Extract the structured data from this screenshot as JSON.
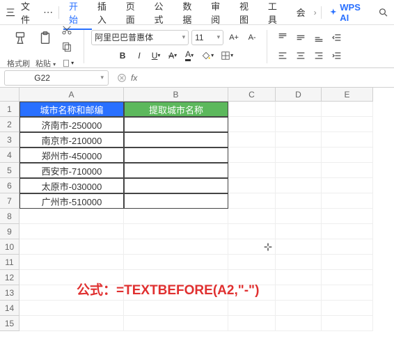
{
  "menubar": {
    "hamburger": "三",
    "file": "文件",
    "more": "⋯",
    "tabs": [
      "开始",
      "插入",
      "页面",
      "公式",
      "数据",
      "审阅",
      "视图",
      "工具",
      "会"
    ],
    "active_tab_index": 0,
    "overflow": "›",
    "wps_ai": "WPS AI"
  },
  "ribbon": {
    "format_painter": "格式刷",
    "paste": "粘贴",
    "font_name": "阿里巴巴普惠体",
    "font_size": "11",
    "bold": "B",
    "italic": "I",
    "underline": "U",
    "font_increase": "A+",
    "font_decrease": "A-"
  },
  "namebox": {
    "ref": "G22"
  },
  "formula_bar": {
    "fx": "fx",
    "value": ""
  },
  "columns": [
    "A",
    "B",
    "C",
    "D",
    "E"
  ],
  "row_count": 15,
  "table": {
    "header_a": "城市名称和邮编",
    "header_b": "提取城市名称",
    "rows": [
      {
        "a": "济南市-250000",
        "b": ""
      },
      {
        "a": "南京市-210000",
        "b": ""
      },
      {
        "a": "郑州市-450000",
        "b": ""
      },
      {
        "a": "西安市-710000",
        "b": ""
      },
      {
        "a": "太原市-030000",
        "b": ""
      },
      {
        "a": "广州市-510000",
        "b": ""
      }
    ]
  },
  "formula_overlay": "公式：=TEXTBEFORE(A2,\"-\")"
}
